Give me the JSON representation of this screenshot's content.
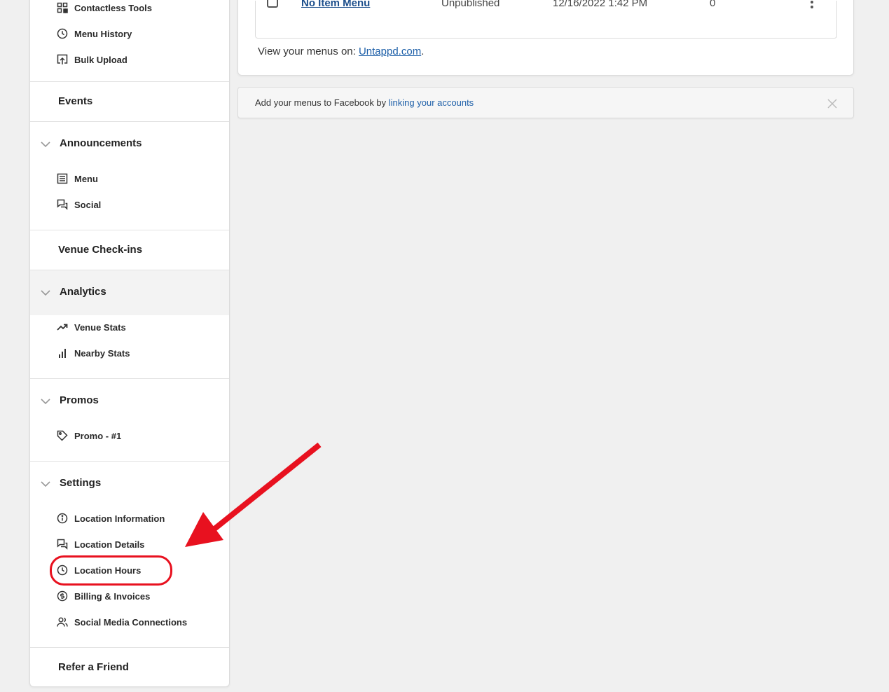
{
  "sidebar": {
    "menu_tools": [
      {
        "label": "Contactless Tools",
        "icon": "qr-code-icon"
      },
      {
        "label": "Menu History",
        "icon": "clock-icon"
      },
      {
        "label": "Bulk Upload",
        "icon": "upload-icon"
      }
    ],
    "events": {
      "label": "Events"
    },
    "announcements": {
      "label": "Announcements",
      "items": [
        {
          "label": "Menu",
          "icon": "menu-list-icon"
        },
        {
          "label": "Social",
          "icon": "chat-bubbles-icon"
        }
      ]
    },
    "venue_checkins": {
      "label": "Venue Check-ins"
    },
    "analytics": {
      "label": "Analytics",
      "items": [
        {
          "label": "Venue Stats",
          "icon": "trending-up-icon"
        },
        {
          "label": "Nearby Stats",
          "icon": "bar-chart-icon"
        }
      ]
    },
    "promos": {
      "label": "Promos",
      "items": [
        {
          "label": "Promo - #1",
          "icon": "tag-icon"
        }
      ]
    },
    "settings": {
      "label": "Settings",
      "items": [
        {
          "label": "Location Information",
          "icon": "info-circle-icon"
        },
        {
          "label": "Location Details",
          "icon": "chat-bubbles-icon"
        },
        {
          "label": "Location Hours",
          "icon": "clock-icon"
        },
        {
          "label": "Billing & Invoices",
          "icon": "dollar-circle-icon"
        },
        {
          "label": "Social Media Connections",
          "icon": "users-icon"
        }
      ]
    },
    "refer": {
      "label": "Refer a Friend"
    }
  },
  "menus_table": {
    "row": {
      "name": "No Item Menu",
      "status": "Unpublished",
      "updated": "12/16/2022 1:42 PM",
      "count": "0"
    }
  },
  "view_menus": {
    "prefix": "View your menus on: ",
    "link": "Untappd.com",
    "suffix": "."
  },
  "facebook_banner": {
    "prefix": "Add your menus to Facebook by ",
    "link": "linking your accounts"
  },
  "annotation": {
    "color": "#e8111f",
    "highlighted_item": "Location Hours"
  }
}
